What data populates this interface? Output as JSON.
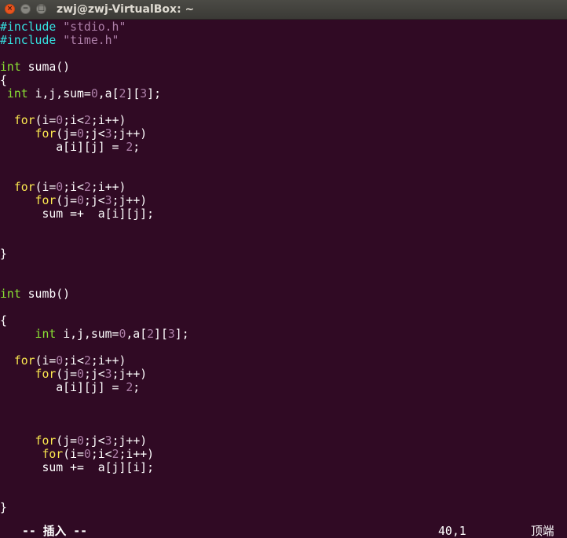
{
  "window": {
    "title": "zwj@zwj-VirtualBox: ~",
    "close_glyph": "×",
    "min_glyph": "−",
    "max_glyph": "□"
  },
  "colors": {
    "background": "#300a24",
    "preproc": "#34e2e2",
    "string": "#ad7fa8",
    "number": "#ad7fa8",
    "keyword": "#fce94f",
    "type": "#8ae234",
    "text": "#ffffff"
  },
  "code_lines": [
    [
      {
        "t": "#include ",
        "k": "preproc"
      },
      {
        "t": "\"stdio.h\"",
        "k": "string"
      }
    ],
    [
      {
        "t": "#include ",
        "k": "preproc"
      },
      {
        "t": "\"time.h\"",
        "k": "string"
      }
    ],
    [],
    [
      {
        "t": "int",
        "k": "type"
      },
      {
        "t": " suma()",
        "k": "text"
      }
    ],
    [
      {
        "t": "{",
        "k": "text"
      }
    ],
    [
      {
        "t": " ",
        "k": "text"
      },
      {
        "t": "int",
        "k": "type"
      },
      {
        "t": " i,j,sum=",
        "k": "text"
      },
      {
        "t": "0",
        "k": "number"
      },
      {
        "t": ",a[",
        "k": "text"
      },
      {
        "t": "2",
        "k": "number"
      },
      {
        "t": "][",
        "k": "text"
      },
      {
        "t": "3",
        "k": "number"
      },
      {
        "t": "];",
        "k": "text"
      }
    ],
    [],
    [
      {
        "t": "  ",
        "k": "text"
      },
      {
        "t": "for",
        "k": "keyword"
      },
      {
        "t": "(i=",
        "k": "text"
      },
      {
        "t": "0",
        "k": "number"
      },
      {
        "t": ";i<",
        "k": "text"
      },
      {
        "t": "2",
        "k": "number"
      },
      {
        "t": ";i++)",
        "k": "text"
      }
    ],
    [
      {
        "t": "     ",
        "k": "text"
      },
      {
        "t": "for",
        "k": "keyword"
      },
      {
        "t": "(j=",
        "k": "text"
      },
      {
        "t": "0",
        "k": "number"
      },
      {
        "t": ";j<",
        "k": "text"
      },
      {
        "t": "3",
        "k": "number"
      },
      {
        "t": ";j++)",
        "k": "text"
      }
    ],
    [
      {
        "t": "        a[i][j] = ",
        "k": "text"
      },
      {
        "t": "2",
        "k": "number"
      },
      {
        "t": ";",
        "k": "text"
      }
    ],
    [],
    [],
    [
      {
        "t": "  ",
        "k": "text"
      },
      {
        "t": "for",
        "k": "keyword"
      },
      {
        "t": "(i=",
        "k": "text"
      },
      {
        "t": "0",
        "k": "number"
      },
      {
        "t": ";i<",
        "k": "text"
      },
      {
        "t": "2",
        "k": "number"
      },
      {
        "t": ";i++)",
        "k": "text"
      }
    ],
    [
      {
        "t": "     ",
        "k": "text"
      },
      {
        "t": "for",
        "k": "keyword"
      },
      {
        "t": "(j=",
        "k": "text"
      },
      {
        "t": "0",
        "k": "number"
      },
      {
        "t": ";j<",
        "k": "text"
      },
      {
        "t": "3",
        "k": "number"
      },
      {
        "t": ";j++)",
        "k": "text"
      }
    ],
    [
      {
        "t": "      sum =+  a[i][j];",
        "k": "text"
      }
    ],
    [],
    [],
    [
      {
        "t": "}",
        "k": "text"
      }
    ],
    [],
    [],
    [
      {
        "t": "int",
        "k": "type"
      },
      {
        "t": " sumb()",
        "k": "text"
      }
    ],
    [],
    [
      {
        "t": "{",
        "k": "text"
      }
    ],
    [
      {
        "t": "     ",
        "k": "text"
      },
      {
        "t": "int",
        "k": "type"
      },
      {
        "t": " i,j,sum=",
        "k": "text"
      },
      {
        "t": "0",
        "k": "number"
      },
      {
        "t": ",a[",
        "k": "text"
      },
      {
        "t": "2",
        "k": "number"
      },
      {
        "t": "][",
        "k": "text"
      },
      {
        "t": "3",
        "k": "number"
      },
      {
        "t": "];",
        "k": "text"
      }
    ],
    [],
    [
      {
        "t": "  ",
        "k": "text"
      },
      {
        "t": "for",
        "k": "keyword"
      },
      {
        "t": "(i=",
        "k": "text"
      },
      {
        "t": "0",
        "k": "number"
      },
      {
        "t": ";i<",
        "k": "text"
      },
      {
        "t": "2",
        "k": "number"
      },
      {
        "t": ";i++)",
        "k": "text"
      }
    ],
    [
      {
        "t": "     ",
        "k": "text"
      },
      {
        "t": "for",
        "k": "keyword"
      },
      {
        "t": "(j=",
        "k": "text"
      },
      {
        "t": "0",
        "k": "number"
      },
      {
        "t": ";j<",
        "k": "text"
      },
      {
        "t": "3",
        "k": "number"
      },
      {
        "t": ";j++)",
        "k": "text"
      }
    ],
    [
      {
        "t": "        a[i][j] = ",
        "k": "text"
      },
      {
        "t": "2",
        "k": "number"
      },
      {
        "t": ";",
        "k": "text"
      }
    ],
    [],
    [],
    [],
    [
      {
        "t": "     ",
        "k": "text"
      },
      {
        "t": "for",
        "k": "keyword"
      },
      {
        "t": "(j=",
        "k": "text"
      },
      {
        "t": "0",
        "k": "number"
      },
      {
        "t": ";j<",
        "k": "text"
      },
      {
        "t": "3",
        "k": "number"
      },
      {
        "t": ";j++)",
        "k": "text"
      }
    ],
    [
      {
        "t": "      ",
        "k": "text"
      },
      {
        "t": "for",
        "k": "keyword"
      },
      {
        "t": "(i=",
        "k": "text"
      },
      {
        "t": "0",
        "k": "number"
      },
      {
        "t": ";i<",
        "k": "text"
      },
      {
        "t": "2",
        "k": "number"
      },
      {
        "t": ";i++)",
        "k": "text"
      }
    ],
    [
      {
        "t": "      sum +=  a[j][i];",
        "k": "text"
      }
    ],
    [],
    [],
    [
      {
        "t": "}",
        "k": "text"
      }
    ]
  ],
  "status": {
    "mode": "-- 插入 --",
    "position": "40,1",
    "scroll": "顶端"
  }
}
